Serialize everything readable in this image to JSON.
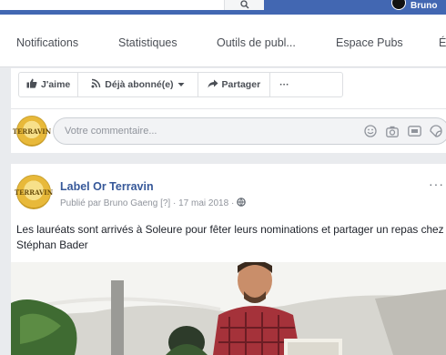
{
  "topbar": {
    "user_name": "Bruno"
  },
  "nav": {
    "items": [
      {
        "label": "Notifications"
      },
      {
        "label": "Statistiques"
      },
      {
        "label": "Outils de publ..."
      },
      {
        "label": "Espace Pubs"
      },
      {
        "label": "É"
      }
    ]
  },
  "actions": {
    "like": "J'aime",
    "subscribed": "Déjà abonné(e)",
    "share": "Partager",
    "more": "···"
  },
  "comment": {
    "placeholder": "Votre commentaire..."
  },
  "post": {
    "page_name": "Label Or Terravin",
    "published_by": "Publié par Bruno Gaeng",
    "info_mark": "[?]",
    "date": "17 mai 2018",
    "separator": "·",
    "text": "Les lauréats sont arrivés à Soleure pour fêter leurs nominations et partager un repas chez Stéphan Bader",
    "more": "···"
  },
  "logo": {
    "text": "TERRAVIN"
  },
  "colors": {
    "brand": "#4267b2",
    "link": "#365899",
    "text": "#1d2129",
    "muted": "#90949c"
  }
}
